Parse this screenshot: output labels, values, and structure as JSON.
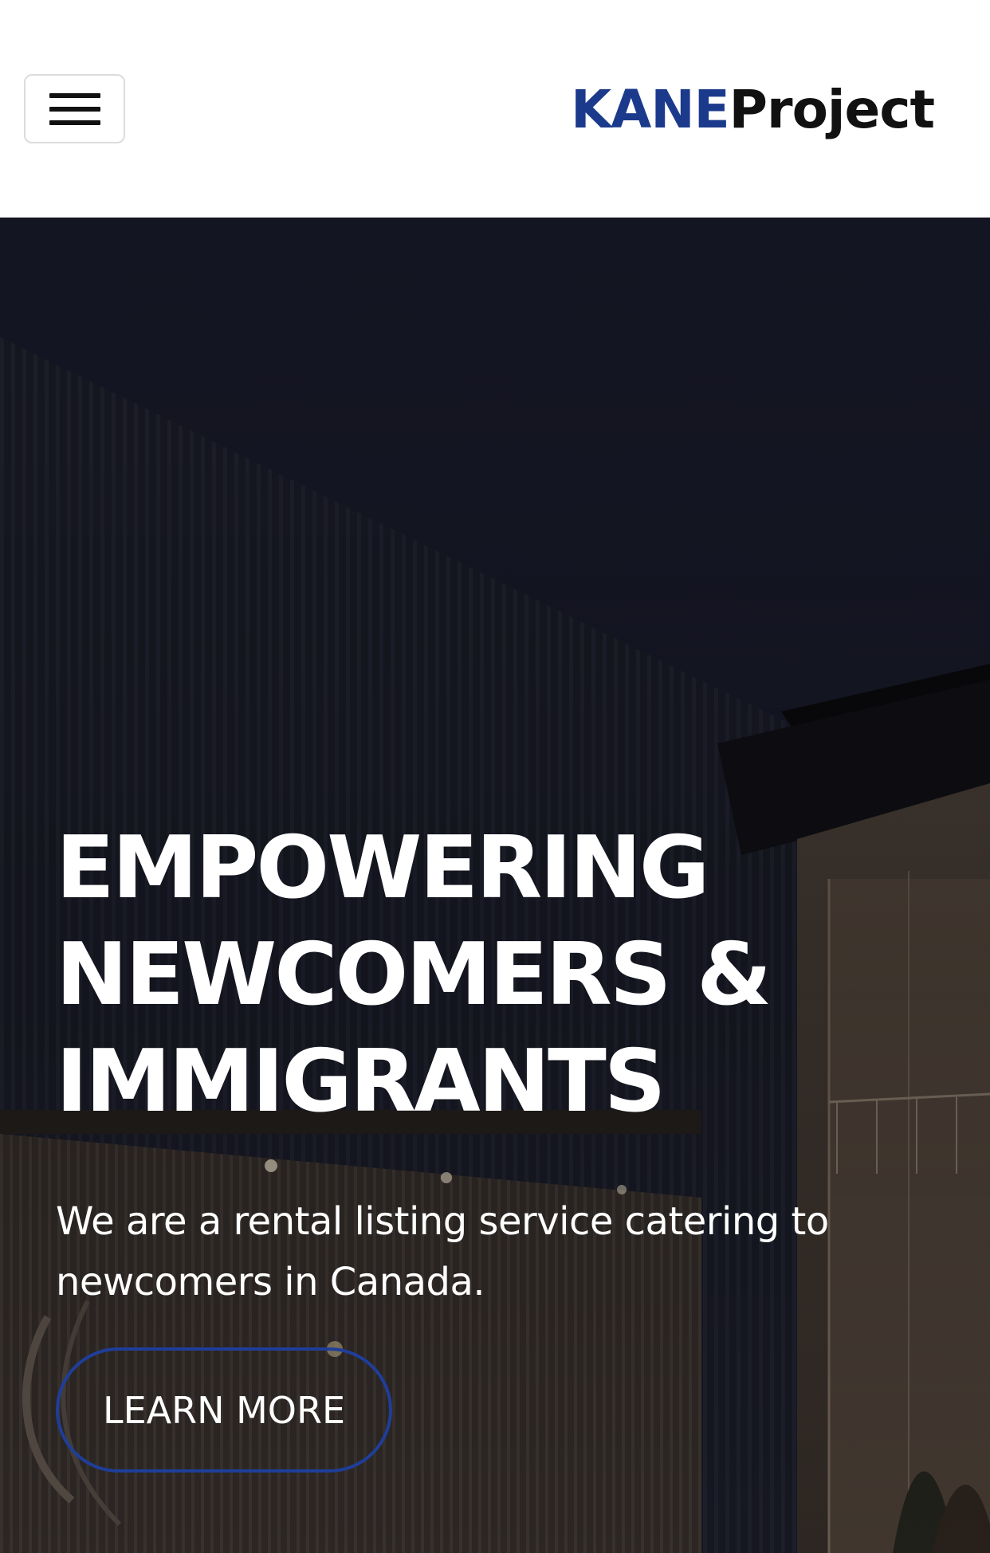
{
  "header": {
    "menu_icon": "hamburger-menu-icon",
    "brand": {
      "part1": "KANE",
      "part2": "Project",
      "part1_color": "#1b3a8c",
      "part2_color": "#111111"
    }
  },
  "hero": {
    "title_lines": [
      "EMPOWERING",
      "NEWCOMERS &",
      "IMMIGRANTS"
    ],
    "subtitle": "We are a rental listing service catering to newcomers in Canada.",
    "cta_label": "LEARN MORE",
    "cta_border_color": "#1f3e99"
  }
}
